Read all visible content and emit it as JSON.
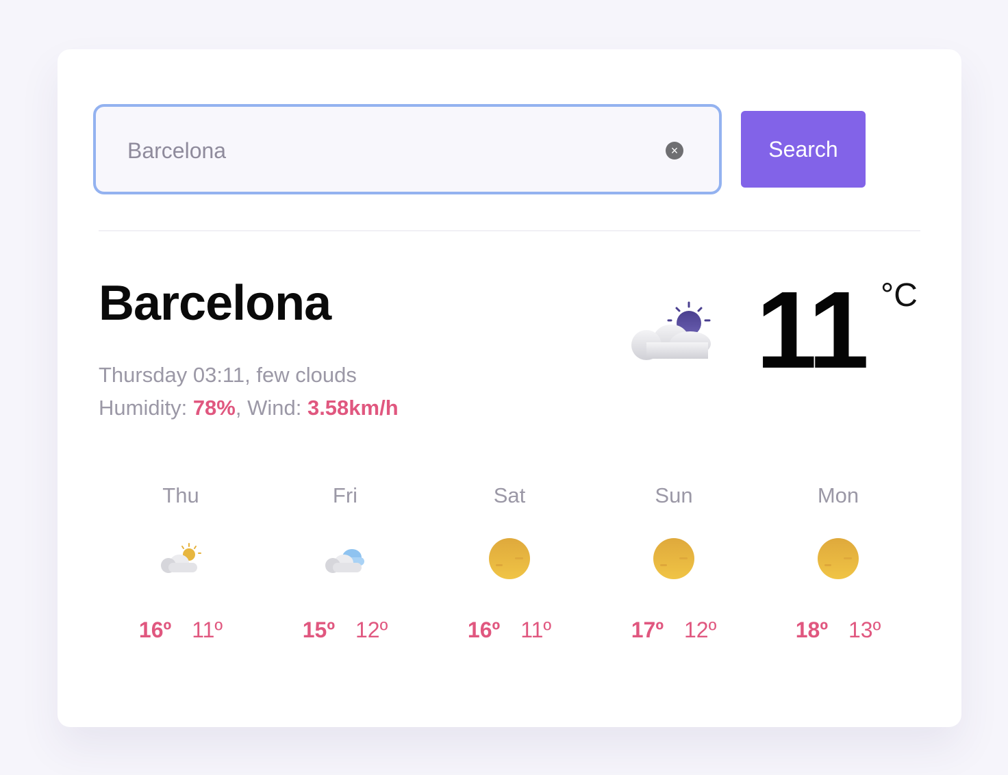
{
  "search": {
    "value": "Barcelona",
    "clear_icon": "×",
    "button_label": "Search"
  },
  "current": {
    "city": "Barcelona",
    "day_time": "Thursday 03:11",
    "separator": ", ",
    "description": "few clouds",
    "humidity_label": "Humidity: ",
    "humidity": "78%",
    "wind_label": ", Wind: ",
    "wind": "3.58km/h",
    "temperature": "11",
    "unit": "°C",
    "icon": "few-clouds-night-icon"
  },
  "forecast": [
    {
      "day": "Thu",
      "icon": "partly-cloudy-icon",
      "high": "16º",
      "low": "11º"
    },
    {
      "day": "Fri",
      "icon": "cloudy-icon",
      "high": "15º",
      "low": "12º"
    },
    {
      "day": "Sat",
      "icon": "sun-icon",
      "high": "16º",
      "low": "11º"
    },
    {
      "day": "Sun",
      "icon": "sun-icon",
      "high": "17º",
      "low": "12º"
    },
    {
      "day": "Mon",
      "icon": "sun-icon",
      "high": "18º",
      "low": "13º"
    }
  ],
  "colors": {
    "accent": "#e0577f",
    "button": "#8263e8",
    "input_border": "#93b2f0",
    "muted_text": "#9b98a6"
  }
}
